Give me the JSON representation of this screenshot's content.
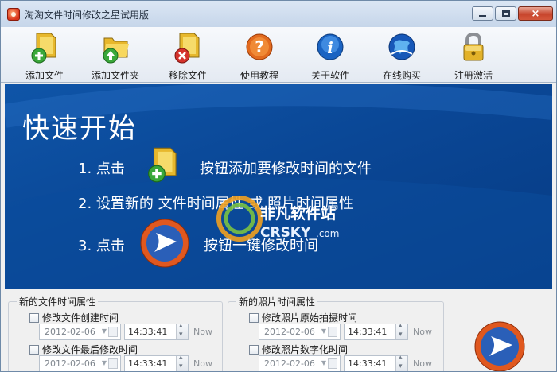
{
  "window": {
    "title": "淘淘文件时间修改之星试用版",
    "controls": {
      "minimize": "minimize",
      "maximize": "maximize",
      "close": "×"
    }
  },
  "toolbar": {
    "items": [
      {
        "label": "添加文件",
        "icon": "add-file-icon"
      },
      {
        "label": "添加文件夹",
        "icon": "add-folder-icon"
      },
      {
        "label": "移除文件",
        "icon": "remove-file-icon"
      },
      {
        "label": "使用教程",
        "icon": "help-icon"
      },
      {
        "label": "关于软件",
        "icon": "info-icon"
      },
      {
        "label": "在线购买",
        "icon": "buy-online-icon"
      },
      {
        "label": "注册激活",
        "icon": "lock-icon"
      }
    ]
  },
  "hero": {
    "title": "快速开始",
    "step1_prefix": "1. 点击",
    "step1_suffix": "按钮添加要修改时间的文件",
    "step2": "2. 设置新的 文件时间属性 或 照片时间属性",
    "step3_prefix": "3. 点击",
    "step3_suffix": "按钮一键修改时间",
    "watermark_cn": "非凡软件站",
    "watermark_en": "CRSKY",
    "watermark_dot": ".com"
  },
  "file_group": {
    "title": "新的文件时间属性",
    "rows": [
      {
        "label": "修改文件创建时间",
        "date": "2012-02-06",
        "time": "14:33:41",
        "now": "Now"
      },
      {
        "label": "修改文件最后修改时间",
        "date": "2012-02-06",
        "time": "14:33:41",
        "now": "Now"
      }
    ]
  },
  "photo_group": {
    "title": "新的照片时间属性",
    "rows": [
      {
        "label": "修改照片原始拍摄时间",
        "date": "2012-02-06",
        "time": "14:33:41",
        "now": "Now"
      },
      {
        "label": "修改照片数字化时间",
        "date": "2012-02-06",
        "time": "14:33:41",
        "now": "Now"
      }
    ]
  },
  "colors": {
    "hero_bg": "#0a4796",
    "titlebar": "#c6d6ea",
    "close_red": "#c7452c",
    "accent_orange": "#e0581f"
  }
}
